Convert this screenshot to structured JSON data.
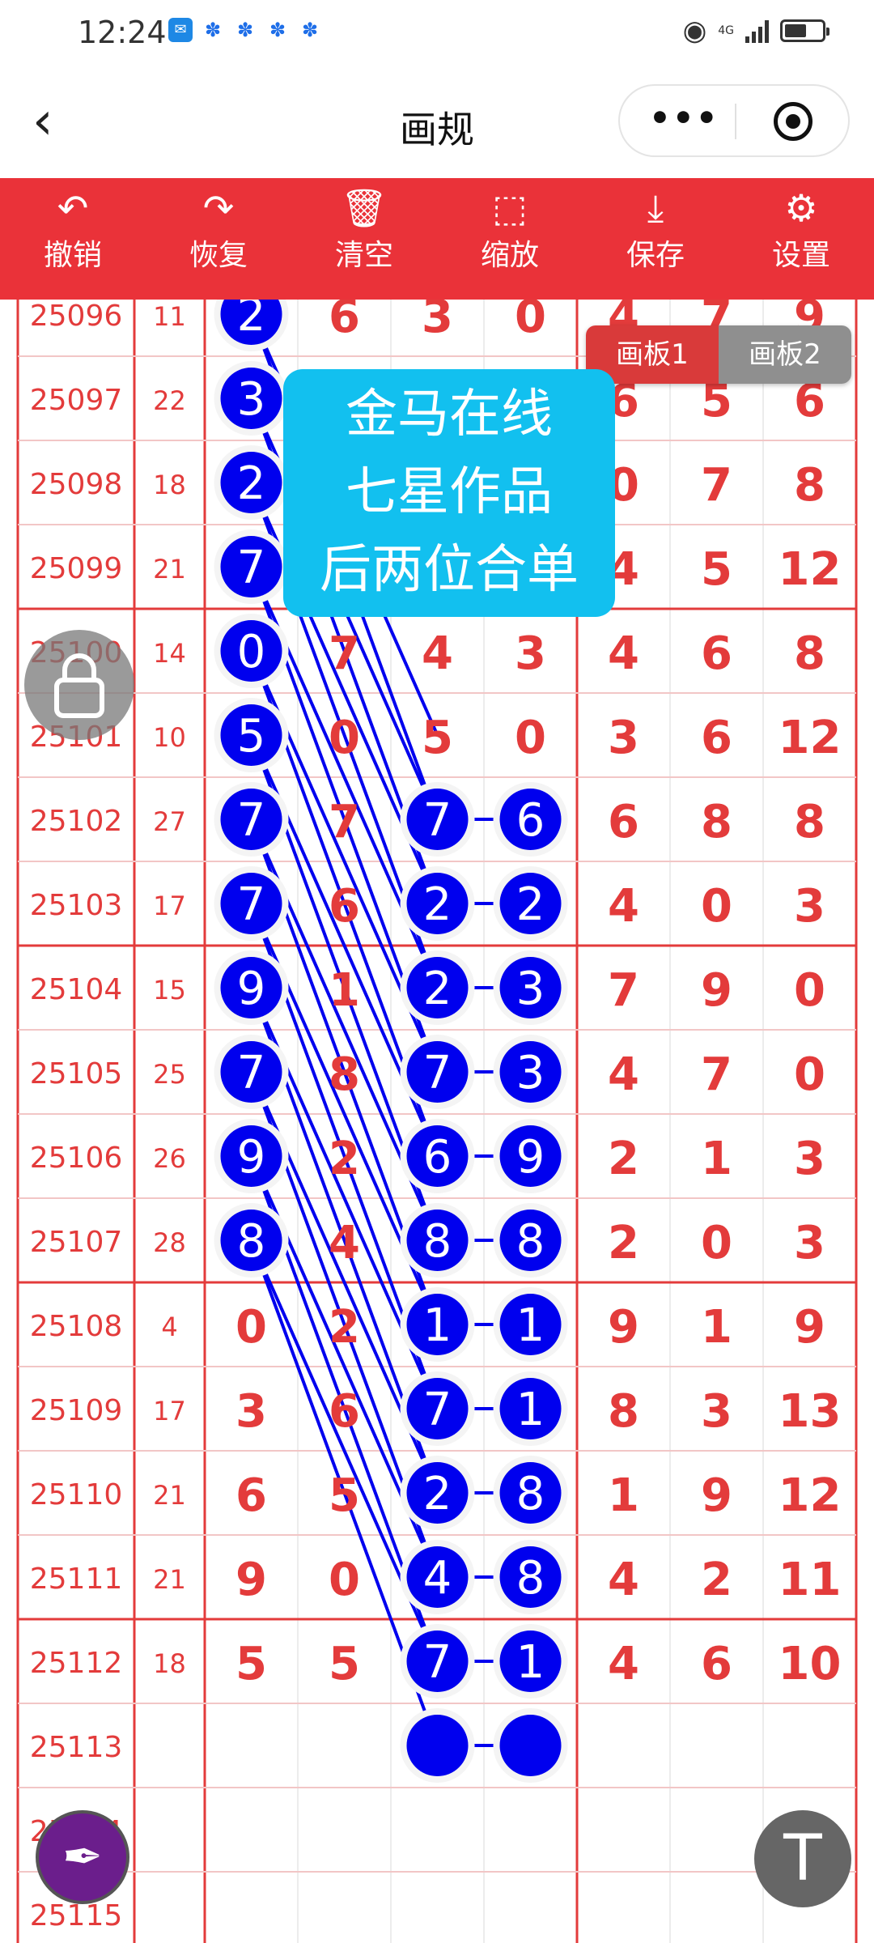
{
  "status_bar": {
    "time": "12:24",
    "network": "4G"
  },
  "title_bar": {
    "title": "画规",
    "more_icon": "more-dots-icon",
    "target_icon": "target-icon"
  },
  "toolbar": {
    "items": [
      {
        "label": "撤销",
        "icon": "undo-icon"
      },
      {
        "label": "恢复",
        "icon": "redo-icon"
      },
      {
        "label": "清空",
        "icon": "trash-icon"
      },
      {
        "label": "缩放",
        "icon": "zoom-icon"
      },
      {
        "label": "保存",
        "icon": "download-icon"
      },
      {
        "label": "设置",
        "icon": "gear-icon"
      }
    ]
  },
  "tabs": [
    "画板1",
    "画板2"
  ],
  "banner": [
    "金马在线",
    "七星作品",
    "后两位合单"
  ],
  "colors": {
    "red": "#e33b3b",
    "toolbar": "#ea3239",
    "blue": "#0000ee",
    "cyan": "#12c0ef",
    "grid": "#ececec"
  },
  "rows": [
    {
      "id": "25096",
      "sum": "11",
      "d": [
        "2",
        "6",
        "3",
        "0",
        "4",
        "7",
        "9"
      ]
    },
    {
      "id": "25097",
      "sum": "22",
      "d": [
        "3",
        "",
        "",
        "",
        "6",
        "5",
        "6"
      ]
    },
    {
      "id": "25098",
      "sum": "18",
      "d": [
        "2",
        "",
        "",
        "",
        "0",
        "7",
        "8"
      ]
    },
    {
      "id": "25099",
      "sum": "21",
      "d": [
        "7",
        "",
        "",
        "",
        "4",
        "5",
        "12"
      ]
    },
    {
      "id": "25100",
      "sum": "14",
      "d": [
        "0",
        "7",
        "4",
        "3",
        "4",
        "6",
        "8"
      ]
    },
    {
      "id": "25101",
      "sum": "10",
      "d": [
        "5",
        "0",
        "5",
        "0",
        "3",
        "6",
        "12"
      ]
    },
    {
      "id": "25102",
      "sum": "27",
      "d": [
        "7",
        "7",
        "7",
        "6",
        "6",
        "8",
        "8"
      ]
    },
    {
      "id": "25103",
      "sum": "17",
      "d": [
        "7",
        "6",
        "2",
        "2",
        "4",
        "0",
        "3"
      ]
    },
    {
      "id": "25104",
      "sum": "15",
      "d": [
        "9",
        "1",
        "2",
        "3",
        "7",
        "9",
        "0"
      ]
    },
    {
      "id": "25105",
      "sum": "25",
      "d": [
        "7",
        "8",
        "7",
        "3",
        "4",
        "7",
        "0"
      ]
    },
    {
      "id": "25106",
      "sum": "26",
      "d": [
        "9",
        "2",
        "6",
        "9",
        "2",
        "1",
        "3"
      ]
    },
    {
      "id": "25107",
      "sum": "28",
      "d": [
        "8",
        "4",
        "8",
        "8",
        "2",
        "0",
        "3"
      ]
    },
    {
      "id": "25108",
      "sum": "4",
      "d": [
        "0",
        "2",
        "1",
        "1",
        "9",
        "1",
        "9"
      ]
    },
    {
      "id": "25109",
      "sum": "17",
      "d": [
        "3",
        "6",
        "7",
        "1",
        "8",
        "3",
        "13"
      ]
    },
    {
      "id": "25110",
      "sum": "21",
      "d": [
        "6",
        "5",
        "2",
        "8",
        "1",
        "9",
        "12"
      ]
    },
    {
      "id": "25111",
      "sum": "21",
      "d": [
        "9",
        "0",
        "4",
        "8",
        "4",
        "2",
        "11"
      ]
    },
    {
      "id": "25112",
      "sum": "18",
      "d": [
        "5",
        "5",
        "7",
        "1",
        "4",
        "6",
        "10"
      ]
    },
    {
      "id": "25113",
      "sum": "",
      "d": [
        "",
        "",
        "",
        "",
        "",
        "",
        ""
      ]
    },
    {
      "id": "25114",
      "sum": "",
      "d": [
        "",
        "",
        "",
        "",
        "",
        "",
        ""
      ]
    },
    {
      "id": "25115",
      "sum": "",
      "d": [
        "",
        "",
        "",
        "",
        "",
        "",
        ""
      ]
    }
  ],
  "marks": {
    "col1_rows": [
      0,
      1,
      2,
      3,
      4,
      5,
      6,
      7,
      8,
      9,
      10,
      11
    ],
    "col34_rows": [
      6,
      7,
      8,
      9,
      10,
      11,
      12,
      13,
      14,
      15,
      16
    ],
    "empty_pair_row": 17
  }
}
